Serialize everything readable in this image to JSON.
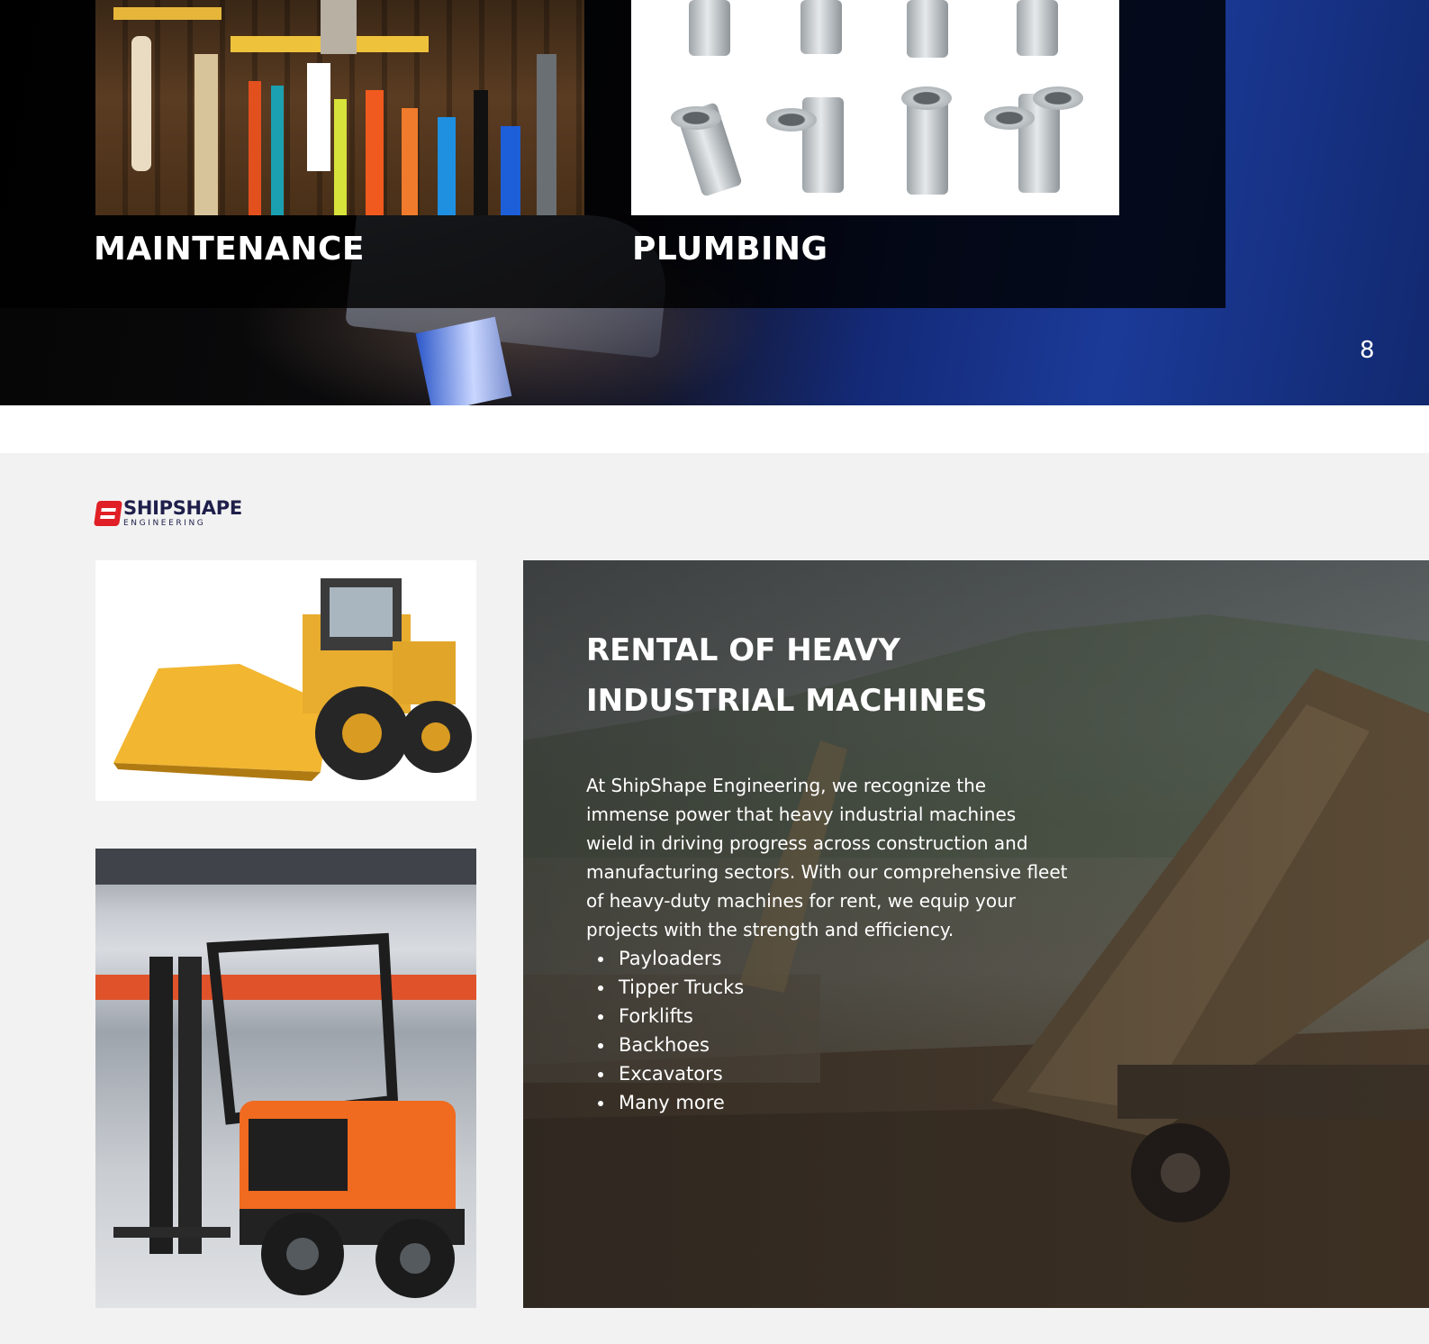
{
  "top_slide": {
    "services": [
      {
        "label": "MAINTENANCE",
        "image": "tools-on-pegboard"
      },
      {
        "label": "PLUMBING",
        "image": "pvc-pipe-fittings"
      }
    ],
    "page_number": "8"
  },
  "bottom_slide": {
    "logo": {
      "name": "SHIPSHAPE",
      "subtitle": "ENGINEERING",
      "mark_color": "#e01f26",
      "text_color": "#1f1f4b"
    },
    "images": [
      "wheel-loader",
      "forklift"
    ],
    "hero": {
      "title": "RENTAL OF HEAVY INDUSTRIAL MACHINES",
      "body": "At ShipShape Engineering, we recognize the immense power that heavy industrial machines wield in driving progress across construction and manufacturing sectors. With our comprehensive fleet of heavy-duty machines for rent, we equip your projects with the strength and efficiency.",
      "items": [
        "Payloaders",
        "Tipper Trucks",
        "Forklifts",
        "Backhoes",
        "Excavators",
        "Many more"
      ]
    }
  }
}
